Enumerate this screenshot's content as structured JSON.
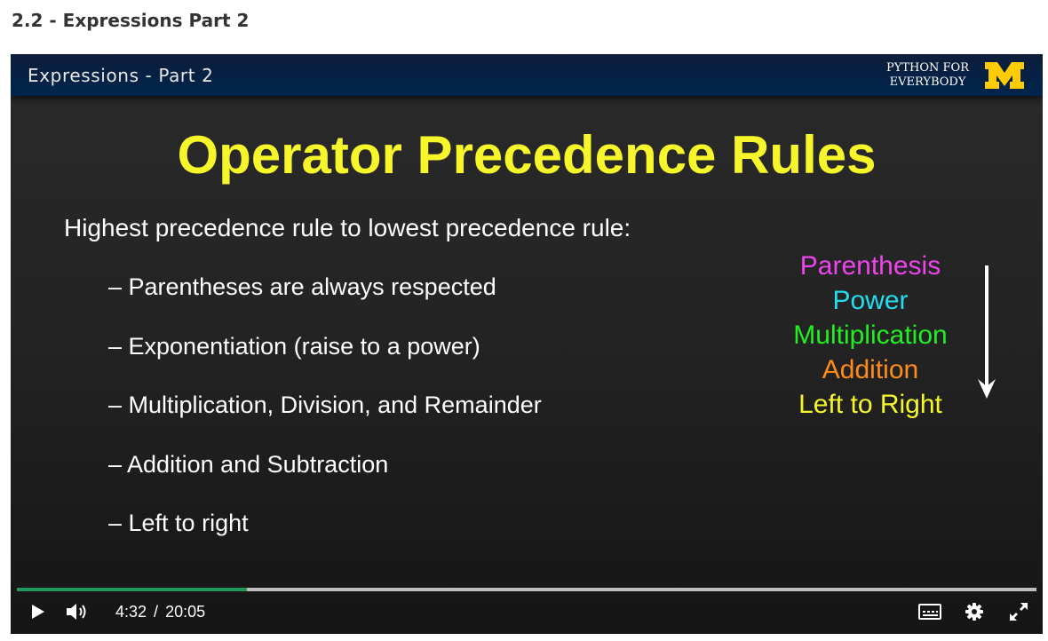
{
  "page": {
    "heading": "2.2 - Expressions Part 2"
  },
  "slide": {
    "header_title": "Expressions - Part 2",
    "brand_line1": "PYTHON FOR",
    "brand_line2": "EVERYBODY",
    "brand_logo_letter": "M",
    "title": "Operator Precedence Rules",
    "subtitle": "Highest precedence rule to lowest precedence rule:",
    "rules": [
      "– Parentheses are always respected",
      "– Exponentiation (raise to a power)",
      "– Multiplication, Division, and Remainder",
      "– Addition and Subtraction",
      "– Left to right"
    ],
    "legend": [
      {
        "label": "Parenthesis",
        "color": "#ee44ee"
      },
      {
        "label": "Power",
        "color": "#22ddee"
      },
      {
        "label": "Multiplication",
        "color": "#22ee22"
      },
      {
        "label": "Addition",
        "color": "#ff8c1a"
      },
      {
        "label": "Left to Right",
        "color": "#f6f62a"
      }
    ],
    "title_color": "#f6f62a",
    "header_color": "#00254d",
    "logo_color": "#ffcb05"
  },
  "player": {
    "current_time": "4:32",
    "separator": "/",
    "duration": "20:05",
    "progress_fraction": 0.226,
    "icons": {
      "play": "play-icon",
      "volume": "volume-icon",
      "captions": "captions-icon",
      "settings": "gear-icon",
      "fullscreen": "fullscreen-icon"
    },
    "accent_color": "#1f9a5a"
  }
}
